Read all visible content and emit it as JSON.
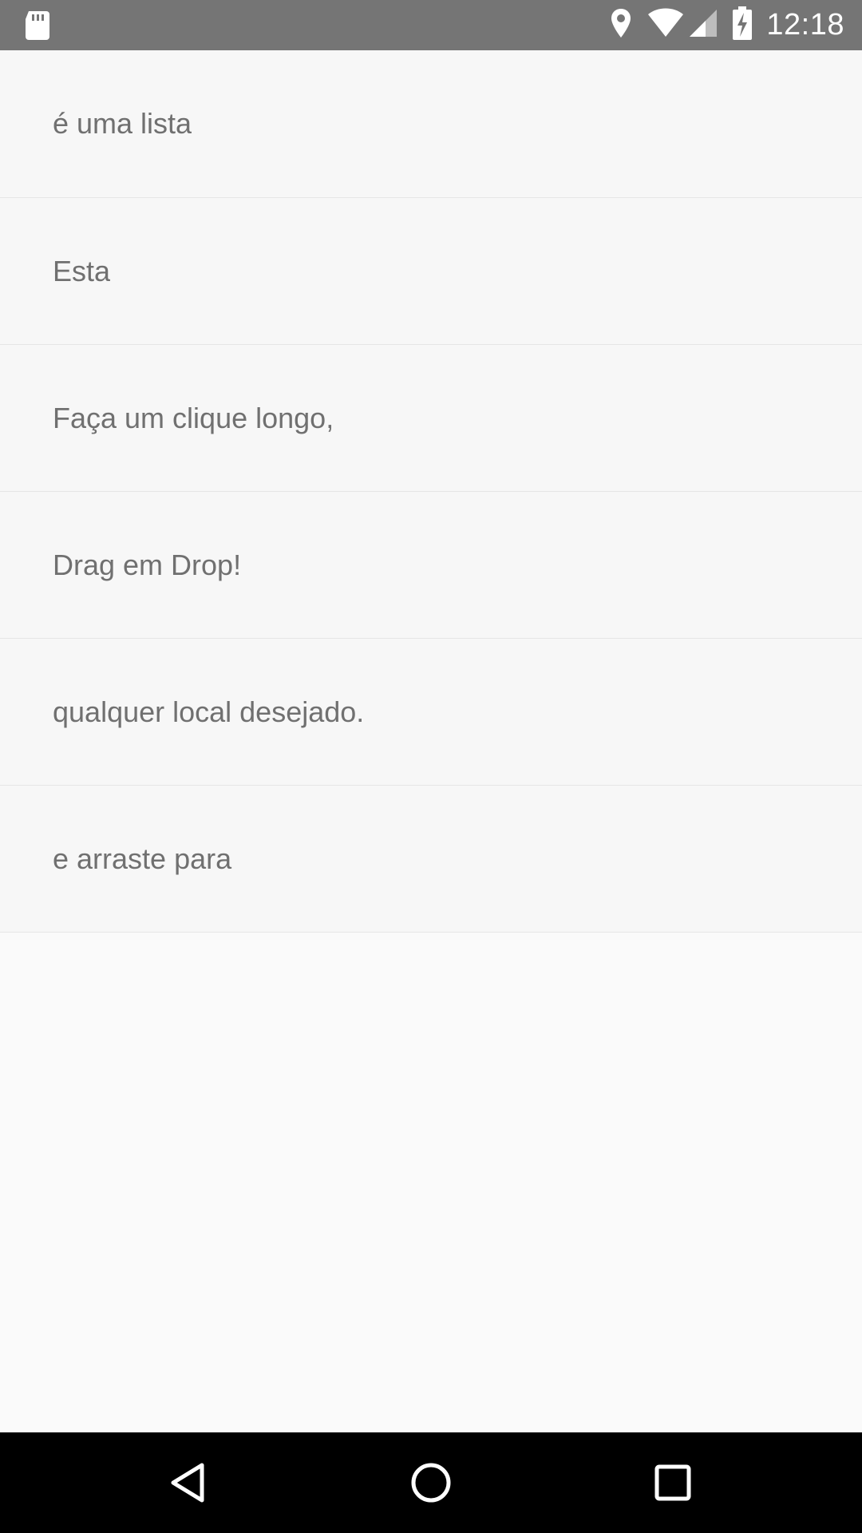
{
  "status_bar": {
    "time": "12:18",
    "icons": [
      "sd-card-icon",
      "location-icon",
      "wifi-icon",
      "signal-icon",
      "battery-charging-icon"
    ]
  },
  "list": {
    "items": [
      {
        "label": "é uma lista"
      },
      {
        "label": "Esta"
      },
      {
        "label": "Faça um clique longo,"
      },
      {
        "label": "Drag em Drop!"
      },
      {
        "label": "qualquer local desejado."
      },
      {
        "label": "e arraste para"
      }
    ]
  },
  "nav_bar": {
    "buttons": [
      "back-icon",
      "home-icon",
      "recents-icon"
    ]
  },
  "colors": {
    "status_bar": "#757575",
    "background": "#fafafa",
    "item_background": "#f7f7f7",
    "divider": "#e6e6e6",
    "text": "#707070",
    "nav_bar": "#000000"
  }
}
